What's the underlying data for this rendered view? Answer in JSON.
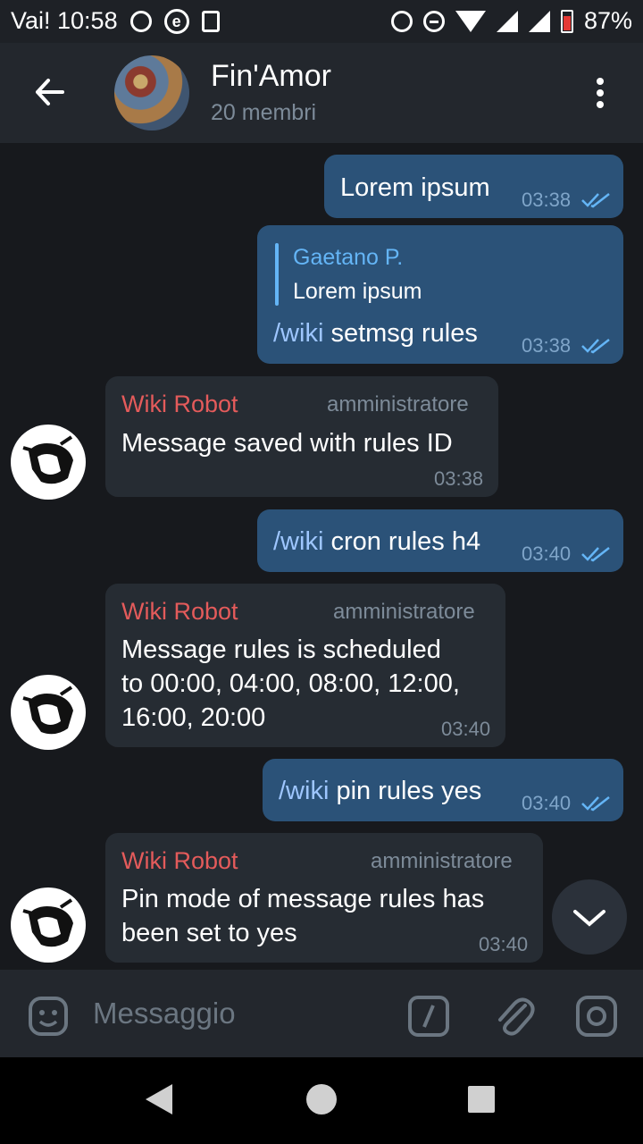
{
  "status_bar": {
    "carrier_time": "Vai! 10:58",
    "battery": "87%"
  },
  "header": {
    "title": "Fin'Amor",
    "subtitle": "20 membri"
  },
  "messages": {
    "m1": {
      "text": "Lorem ipsum",
      "time": "03:38"
    },
    "m2": {
      "reply_name": "Gaetano P.",
      "reply_text": "Lorem ipsum",
      "cmd": "/wiki",
      "text": " setmsg rules",
      "time": "03:38"
    },
    "m3": {
      "sender": "Wiki Robot",
      "role": "amministratore",
      "text": "Message saved with rules ID",
      "time": "03:38"
    },
    "m4": {
      "cmd": "/wiki",
      "text": " cron rules h4",
      "time": "03:40"
    },
    "m5": {
      "sender": "Wiki Robot",
      "role": "amministratore",
      "line1": "Message rules is scheduled",
      "line2": "to 00:00, 04:00, 08:00, 12:00,",
      "line3": "16:00, 20:00",
      "time": "03:40"
    },
    "m6": {
      "cmd": "/wiki",
      "text": " pin rules yes",
      "time": "03:40"
    },
    "m7": {
      "sender": "Wiki Robot",
      "role": "amministratore",
      "line1": "Pin mode of message rules has",
      "line2": "been set to yes",
      "time": "03:40"
    }
  },
  "input": {
    "placeholder": "Messaggio"
  },
  "icons": {
    "back": "arrow-left-icon",
    "menu": "more-vertical-icon",
    "emoji": "sticker-icon",
    "commands": "slash-command-icon",
    "attach": "paperclip-icon",
    "camera": "camera-icon",
    "scroll": "chevron-down-icon"
  },
  "colors": {
    "outgoing": "#2b5278",
    "incoming": "#262c33",
    "sender": "#e45b5b",
    "command": "#9ec6ff"
  }
}
